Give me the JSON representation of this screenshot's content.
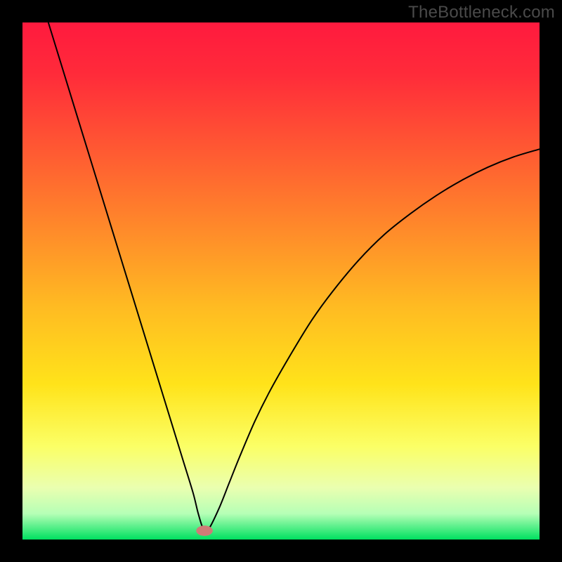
{
  "watermark": "TheBottleneck.com",
  "chart_data": {
    "type": "line",
    "title": "",
    "xlabel": "",
    "ylabel": "",
    "xlim": [
      0,
      100
    ],
    "ylim": [
      0,
      100
    ],
    "background_gradient": {
      "stops": [
        {
          "offset": 0.0,
          "color": "#ff1a3e"
        },
        {
          "offset": 0.1,
          "color": "#ff2b3a"
        },
        {
          "offset": 0.25,
          "color": "#ff5a32"
        },
        {
          "offset": 0.4,
          "color": "#ff8a2a"
        },
        {
          "offset": 0.55,
          "color": "#ffbb22"
        },
        {
          "offset": 0.7,
          "color": "#ffe31a"
        },
        {
          "offset": 0.82,
          "color": "#fbff66"
        },
        {
          "offset": 0.9,
          "color": "#eaffb0"
        },
        {
          "offset": 0.95,
          "color": "#b6ffb6"
        },
        {
          "offset": 1.0,
          "color": "#00e060"
        }
      ]
    },
    "series": [
      {
        "name": "bottleneck-curve",
        "color": "#000000",
        "x": [
          5,
          7,
          9,
          11,
          13,
          15,
          17,
          19,
          21,
          23,
          25,
          27,
          29,
          31,
          33,
          34,
          35,
          36,
          38,
          40,
          42,
          45,
          48,
          52,
          56,
          60,
          65,
          70,
          75,
          80,
          85,
          90,
          95,
          100
        ],
        "y": [
          100,
          93.5,
          87,
          80.5,
          74,
          67.5,
          61,
          54.5,
          48,
          41.5,
          35,
          28.5,
          22,
          15.5,
          9,
          5,
          2,
          2,
          6,
          11,
          16,
          23,
          29,
          36,
          42.5,
          48,
          54,
          59,
          63,
          66.5,
          69.5,
          72,
          74,
          75.5
        ]
      }
    ],
    "marker": {
      "name": "minimum-marker",
      "x": 35.2,
      "y": 1.7,
      "rx": 1.6,
      "ry": 1.0,
      "fill": "#cf7b77"
    }
  }
}
